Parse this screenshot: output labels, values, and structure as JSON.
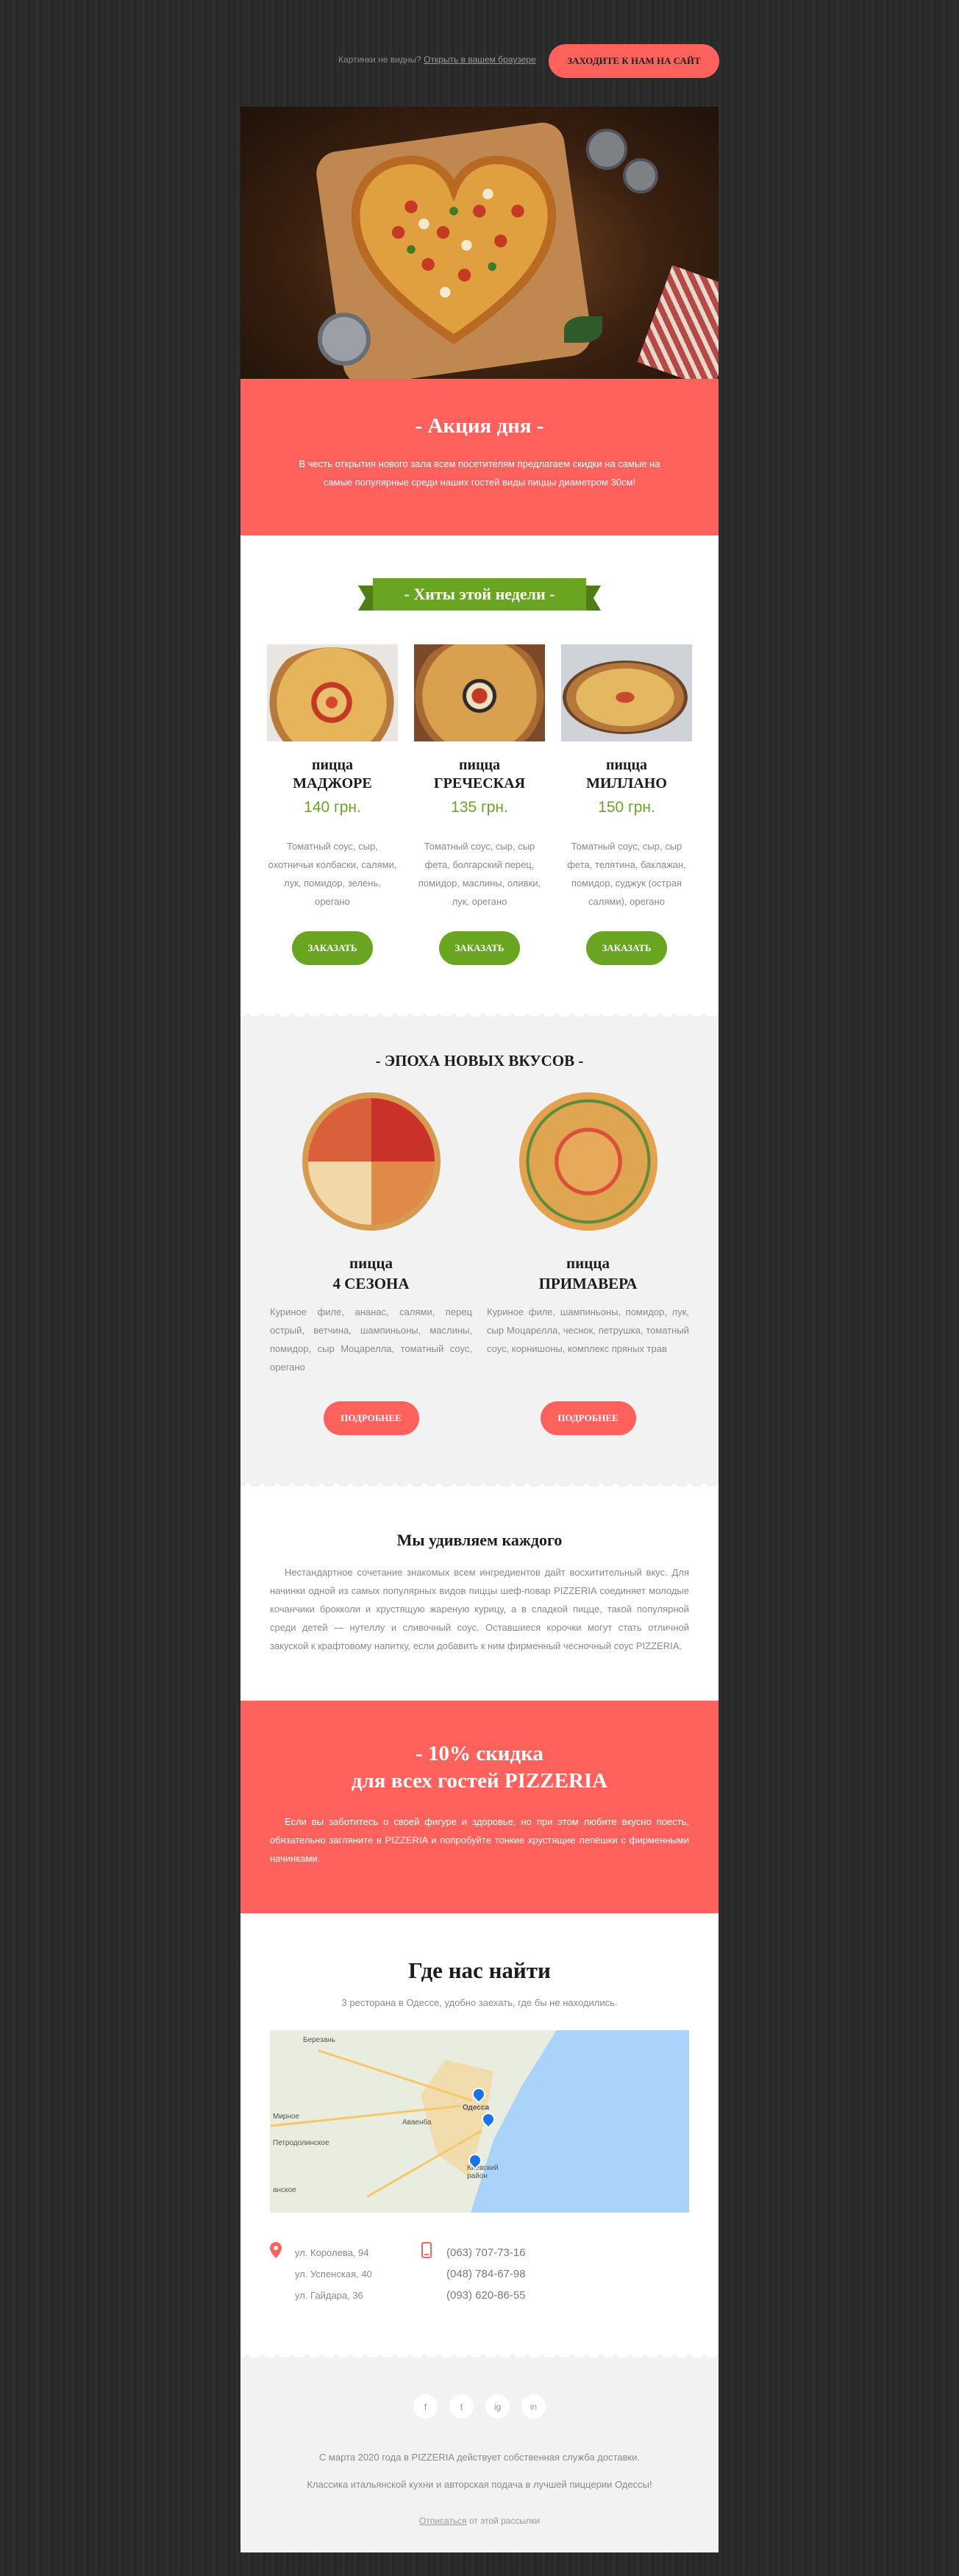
{
  "topbar": {
    "notice_text": "Картинки не видны?",
    "browser_link": "Открыть в вашем браузере",
    "site_button": "ЗАХОДИТЕ К НАМ НА САЙТ"
  },
  "promo": {
    "title": "- Акция дня -",
    "text": "В честь открытия нового зала всем посетителям предлагаем скидки на самые на самые популярные среди наших гостей виды пиццы диаметром 30см!"
  },
  "hits": {
    "ribbon": "- Хиты этой недели -",
    "items": [
      {
        "name_line1": "пицца",
        "name_line2": "МАДЖОРЕ",
        "price": "140 грн.",
        "desc": "Томатный соус, сыр, охотничьи колбаски, салями, лук, помидор, зелень, орегано",
        "button": "ЗАКАЗАТЬ"
      },
      {
        "name_line1": "пицца",
        "name_line2": "ГРЕЧЕСКАЯ",
        "price": "135 грн.",
        "desc": "Томатный соус, сыр, сыр фета, болгарский перец, помидор, маслины, оливки, лук, орегано",
        "button": "ЗАКАЗАТЬ"
      },
      {
        "name_line1": "пицца",
        "name_line2": "МИЛЛАНО",
        "price": "150 грн.",
        "desc": "Томатный соус, сыр, сыр фета, телятина, баклажан, помидор, суджук (острая салями), орегано",
        "button": "ЗАКАЗАТЬ"
      }
    ]
  },
  "new_tastes": {
    "title": "- ЭПОХА НОВЫХ ВКУСОВ -",
    "items": [
      {
        "name_line1": "пицца",
        "name_line2": "4 СЕЗОНА",
        "desc": "Куриное филе, ананас, салями, перец острый, ветчина, шампиньоны, маслины, помидор, сыр Моцарелла, томатный соус, орегано",
        "button": "ПОДРОБНЕЕ"
      },
      {
        "name_line1": "пицца",
        "name_line2": "ПРИМАВЕРА",
        "desc": "Куриное филе, шампиньоны, помидор, лук, сыр Моцарелла, чеснок, петрушка, томатный соус, корнишоны, комплекс пряных трав",
        "button": "ПОДРОБНЕЕ"
      }
    ]
  },
  "surprise": {
    "title": "Мы удивляем каждого",
    "text": "Нестандартное сочетание знакомых всем ингредиентов дайт восхитительный вкус. Для начинки одной из самых популярных видов пиццы шеф-повар PIZZERIA соединяет молодые кочанчики брокколи и хрустящую жареную курицу, а в сладкой пицце, такой популярной среди детей — нутеллу и сливочный соус. Оставшиеся корочки могут стать отличной закуской к крафтовому напитку, если добавить к ним фирменный чесночный соус PIZZERIA."
  },
  "discount": {
    "title_line1": "- 10% скидка",
    "title_line2": "для всех гостей PIZZERIA",
    "text": "Если вы заботитесь о своей фигуре и здоровье, но при этом любите вкусно поесть, обязательно загляните в PIZZERIA и попробуйте тонкие хрустящие лепёшки с фирменными начинками."
  },
  "find": {
    "title": "Где нас найти",
    "subtitle": "3 ресторана в Одессе, удобно заехать, где бы не находились.",
    "map_labels": [
      "Березань",
      "Мирное",
      "Петродолинское",
      "Одесса",
      "Киевский район",
      "Аваенба",
      "анское"
    ],
    "addresses": [
      "ул. Королева, 94",
      "ул. Успенская, 40",
      "ул. Гайдара, 36"
    ],
    "phones": [
      "(063) 707-73-16",
      "(048) 784-67-98",
      "(093) 620-86-55"
    ]
  },
  "footer": {
    "social": [
      "f",
      "t",
      "ig",
      "in"
    ],
    "line1": "С марта 2020 года в PIZZERIA действует собственная служба доставки.",
    "line2": "Классика итальянской кухни и авторская подача в лучшей пиццерии Одессы!",
    "unsubscribe_link": "Отписаться",
    "unsubscribe_rest": " от этой рассылки"
  },
  "colors": {
    "accent": "#ff625c",
    "green": "#6aa521",
    "background": "#2b2b2b"
  }
}
